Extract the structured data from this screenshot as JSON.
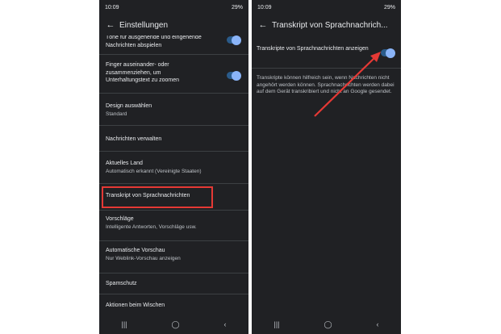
{
  "left": {
    "status_time": "10:09",
    "status_right": "29%",
    "title": "Einstellungen",
    "items": [
      {
        "title": "Töne für ausgehende und eingehende Nachrichten abspielen"
      },
      {
        "title": "Finger auseinander- oder zusammenziehen, um Unterhaltungstext zu zoomen"
      },
      {
        "title": "Design auswählen",
        "subtitle": "Standard"
      },
      {
        "title": "Nachrichten verwalten"
      },
      {
        "title": "Aktuelles Land",
        "subtitle": "Automatisch erkannt (Vereinigte Staaten)"
      },
      {
        "title": "Transkript von Sprachnachrichten"
      },
      {
        "title": "Vorschläge",
        "subtitle": "Intelligente Antworten, Vorschläge usw."
      },
      {
        "title": "Automatische Vorschau",
        "subtitle": "Nur Weblink-Vorschau anzeigen"
      },
      {
        "title": "Spamschutz"
      },
      {
        "title": "Aktionen beim Wischen"
      }
    ]
  },
  "right": {
    "status_time": "10:09",
    "status_right": "29%",
    "title": "Transkript von Sprachnachrich...",
    "setting_label": "Transkripte von Sprachnachrichten anzeigen",
    "description": "Transkripte können hilfreich sein, wenn Nachrichten nicht angehört werden können. Sprachnachrichten werden dabei auf dem Gerät transkribiert und nicht an Google gesendet."
  },
  "colors": {
    "background": "#202124",
    "accent": "#8ab4f8",
    "highlight": "#e53935",
    "arrow": "#e53935"
  },
  "toggles": {
    "left_sounds": true,
    "left_zoom": true,
    "right_transcripts": true
  },
  "icons": {
    "back": "arrow-left-icon",
    "nav_recent": "recent-apps-icon",
    "nav_home": "home-icon",
    "nav_back": "back-chevron-icon"
  }
}
